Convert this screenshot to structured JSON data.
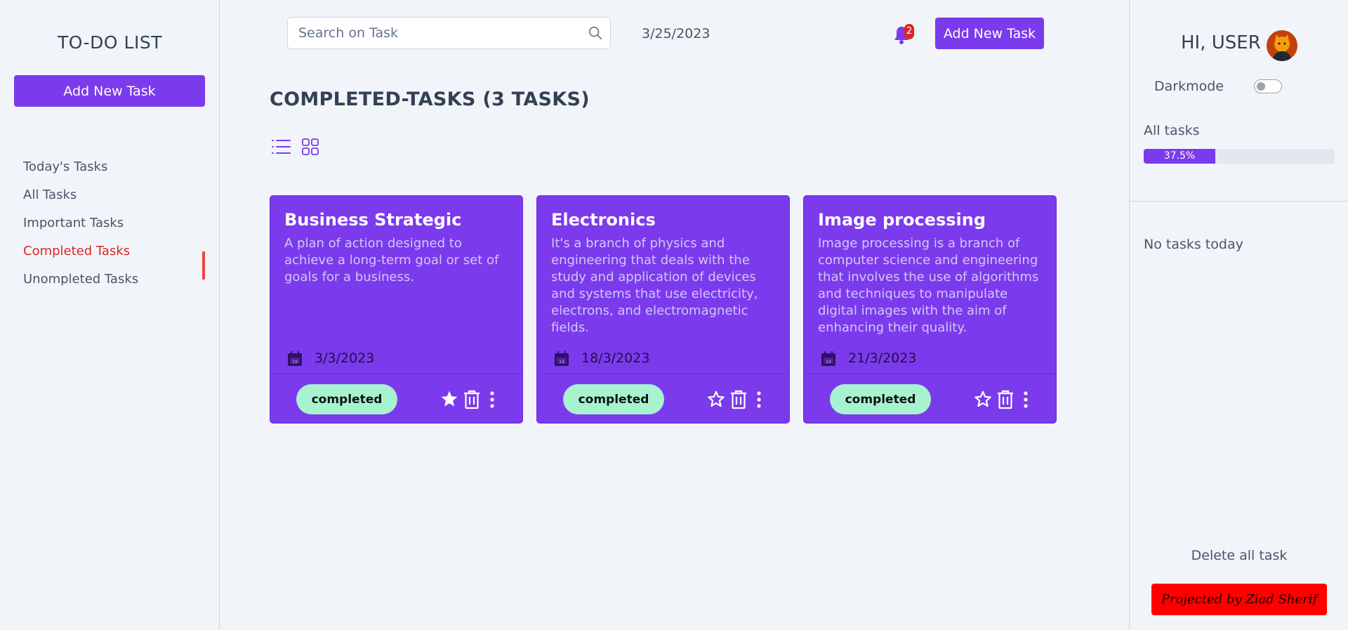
{
  "sidebar": {
    "brand": "TO-DO LIST",
    "add_button": "Add New Task",
    "items": [
      {
        "label": "Today's Tasks"
      },
      {
        "label": "All Tasks"
      },
      {
        "label": "Important Tasks"
      },
      {
        "label": "Completed Tasks",
        "active": true
      },
      {
        "label": "Unompleted Tasks"
      }
    ]
  },
  "header": {
    "search_placeholder": "Search on Task",
    "date": "3/25/2023",
    "notification_count": "2",
    "add_button": "Add New Task"
  },
  "main": {
    "title": "COMPLETED-TASKS (3 TASKS)",
    "views": [
      "list-view-icon",
      "grid-view-icon"
    ],
    "cards": [
      {
        "title": "Business Strategic",
        "description": "A plan of action designed to achieve a long-term goal or set of goals for a business.",
        "date": "3/3/2023",
        "status": "completed",
        "important": true
      },
      {
        "title": "Electronics",
        "description": "It's a branch of physics and engineering that deals with the study and application of devices and systems that use electricity, electrons, and electromagnetic fields.",
        "date": "18/3/2023",
        "status": "completed",
        "important": false
      },
      {
        "title": "Image processing",
        "description": "Image processing is a branch of computer science and engineering that involves the use of algorithms and techniques to manipulate digital images with the aim of enhancing their quality.",
        "date": "21/3/2023",
        "status": "completed",
        "important": false
      }
    ]
  },
  "right_panel": {
    "greeting": "HI, USER",
    "darkmode_label": "Darkmode",
    "darkmode_on": false,
    "all_tasks_label": "All tasks",
    "progress_label": "37.5%",
    "progress_value": 37.5,
    "no_tasks": "No tasks today",
    "delete_all": "Delete all task",
    "credit": "Projected by Ziad Sherif"
  },
  "colors": {
    "accent": "#7c3aed",
    "active_nav": "#dc2626",
    "status_badge": "#a7f3d0",
    "credit_bg": "#ff0000"
  }
}
